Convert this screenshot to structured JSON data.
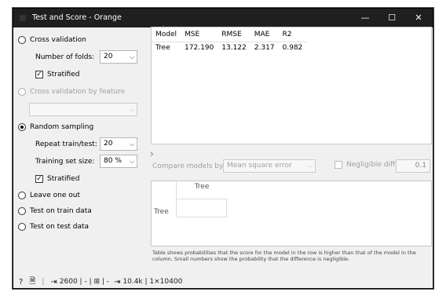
{
  "window": {
    "title": "Test and Score - Orange",
    "minimize": "—",
    "maximize": "☐",
    "close": "✕"
  },
  "sampling": {
    "cross_validation": "Cross validation",
    "number_of_folds_label": "Number of folds:",
    "number_of_folds_value": "20",
    "stratified_1": "Stratified",
    "cross_validation_by_feature": "Cross validation by feature",
    "random_sampling": "Random sampling",
    "repeat_label": "Repeat train/test:",
    "repeat_value": "20",
    "training_size_label": "Training set size:",
    "training_size_value": "80 %",
    "stratified_2": "Stratified",
    "leave_one_out": "Leave one out",
    "test_on_train": "Test on train data",
    "test_on_test": "Test on test data",
    "selected": "random_sampling"
  },
  "scores": {
    "columns": [
      "Model",
      "MSE",
      "RMSE",
      "MAE",
      "R2"
    ],
    "rows": [
      [
        "Tree",
        "172.190",
        "13.122",
        "2.317",
        "0.982"
      ]
    ]
  },
  "compare": {
    "label": "Compare models by:",
    "metric": "Mean square error",
    "negligible_label": "Negligible diff.:",
    "negligible_value": "0.1",
    "col_header": "Tree",
    "row_header": "Tree"
  },
  "note": "Table shows probabilities that the score for the model in the row is higher than that of the model in the column. Small numbers show the probability that the difference is negligible.",
  "status": {
    "help": "?",
    "report": "🗎",
    "input_icon": "⇥",
    "input_summary": "2600 | - | ⊞ | -",
    "output_icon": "⇥",
    "output_summary": "10.4k | 1×10400"
  }
}
